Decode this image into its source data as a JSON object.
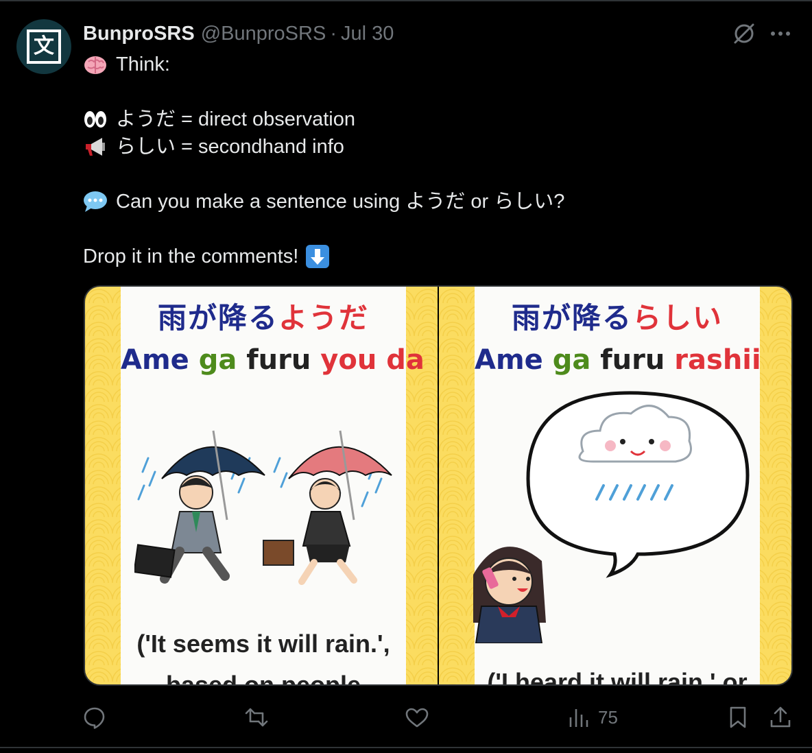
{
  "tweet": {
    "author_name": "BunproSRS",
    "handle": "@BunproSRS",
    "separator": "·",
    "date": "Jul 30",
    "avatar_glyph": "文",
    "lines": {
      "think": "Think:",
      "you_da": "ようだ = direct observation",
      "rashii": "らしい = secondhand info",
      "question": "Can you make a sentence using ようだ or らしい?",
      "drop": "Drop it in the comments!"
    },
    "icons": {
      "think": "brain-emoji",
      "you_da": "eyes-emoji",
      "rashii": "megaphone-emoji",
      "question": "speech-bubble-emoji",
      "drop": "down-arrow-emoji"
    }
  },
  "media": {
    "left": {
      "jp_part1": "雨が降る",
      "jp_part2": "ようだ",
      "rom_ame": "Ame",
      "rom_ga": "ga",
      "rom_furu": "furu",
      "rom_grammar": "you da",
      "caption_line1": "('It seems it will rain.',",
      "caption_line2": "based on people"
    },
    "right": {
      "jp_part1": "雨が降る",
      "jp_part2": "らしい",
      "rom_ame": "Ame",
      "rom_ga": "ga",
      "rom_furu": "furu",
      "rom_grammar": "rashii",
      "caption_line1": "('I heard it will rain.' or"
    }
  },
  "actions": {
    "views": "75"
  },
  "colors": {
    "background": "#000000",
    "text": "#e7e9ea",
    "muted": "#71767b",
    "panel_yellow": "#fbdc60",
    "jp_blue": "#1f2b8c",
    "jp_green": "#4e8b1c",
    "jp_red": "#e0333a"
  }
}
